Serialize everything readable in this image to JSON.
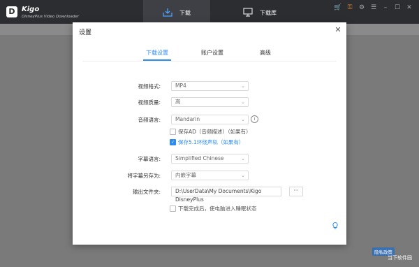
{
  "app": {
    "name": "Kigo",
    "subtitle": "DisneyPlus Video Downloader",
    "logo_letter": "D"
  },
  "nav": {
    "download_label": "下载",
    "library_label": "下载库"
  },
  "toolbar_icons": [
    "cart-icon",
    "key-icon",
    "settings-icon",
    "menu-icon",
    "minimize-icon",
    "maximize-icon",
    "close-icon"
  ],
  "dialog": {
    "title": "设置",
    "tabs": [
      {
        "label": "下载设置",
        "active": true
      },
      {
        "label": "账户设置",
        "active": false
      },
      {
        "label": "高级",
        "active": false
      }
    ],
    "fields": {
      "video_format": {
        "label": "视频格式:",
        "value": "MP4"
      },
      "video_quality": {
        "label": "视频质量:",
        "value": "高"
      },
      "audio_language": {
        "label": "音频语言:",
        "value": "Mandarin"
      },
      "save_ad": {
        "label": "保存AD（音频描述）（如果有）",
        "checked": false
      },
      "save_51": {
        "label": "保存5.1环绕声轨（如果有）",
        "checked": true
      },
      "subtitle_language": {
        "label": "字幕语言:",
        "value": "Simplified Chinese"
      },
      "subtitle_save_as": {
        "label": "将字幕另存为:",
        "value": "内嵌字幕"
      },
      "output_folder": {
        "label": "输出文件夹:",
        "value": "D:\\UserData\\My Documents\\Kigo DisneyPlus",
        "browse": "···"
      },
      "sleep_after": {
        "label": "下载完成后，使电脑进入睡眠状态",
        "checked": false
      }
    }
  },
  "watermark": {
    "badge": "隐私政策",
    "text": "当下软件园"
  },
  "colors": {
    "accent": "#2d8cf0",
    "titlebar": "#2b2d31",
    "toolbar_orange": "#e8882a"
  }
}
